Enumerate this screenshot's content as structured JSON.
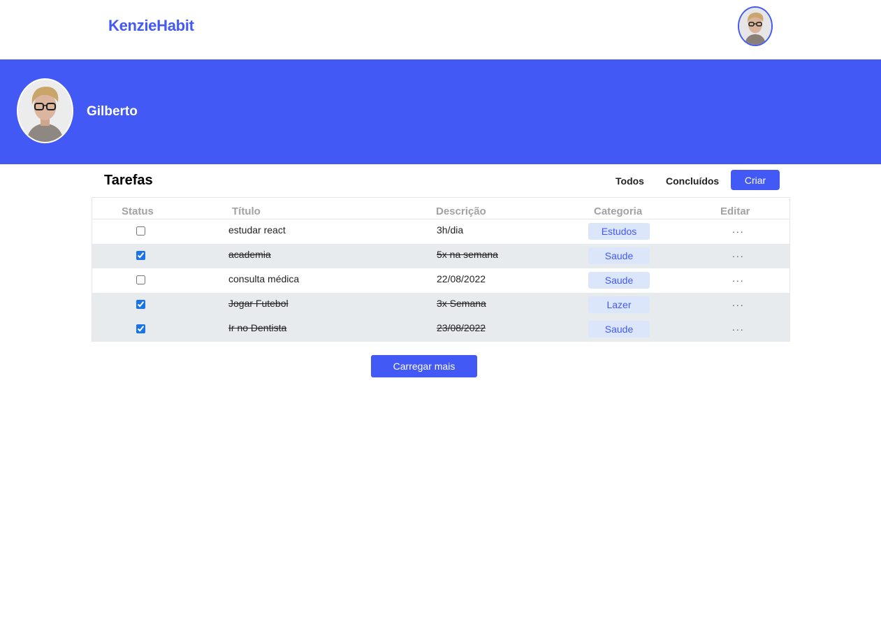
{
  "colors": {
    "primary": "#4259f5",
    "row_done_bg": "#e8ebee",
    "badge_bg": "#dce6fb"
  },
  "header": {
    "brand": "KenzieHabit",
    "avatar_icon": "user-avatar-photo"
  },
  "profile": {
    "name": "Gilberto",
    "avatar_icon": "user-avatar-photo"
  },
  "tasks": {
    "title": "Tarefas",
    "filters": {
      "all": "Todos",
      "completed": "Concluídos",
      "create": "Criar"
    },
    "columns": {
      "status": "Status",
      "title": "Título",
      "description": "Descrição",
      "category": "Categoria",
      "edit": "Editar"
    },
    "rows": [
      {
        "done": false,
        "title": "estudar react",
        "description": "3h/dia",
        "category": "Estudos",
        "edit": "..."
      },
      {
        "done": true,
        "title": "academia",
        "description": "5x na semana",
        "category": "Saude",
        "edit": "..."
      },
      {
        "done": false,
        "title": "consulta médica",
        "description": "22/08/2022",
        "category": "Saude",
        "edit": "..."
      },
      {
        "done": true,
        "title": "Jogar Futebol",
        "description": "3x Semana",
        "category": "Lazer",
        "edit": "..."
      },
      {
        "done": true,
        "title": "Ir no Dentista",
        "description": "23/08/2022",
        "category": "Saude",
        "edit": "..."
      }
    ],
    "load_more": "Carregar mais"
  }
}
